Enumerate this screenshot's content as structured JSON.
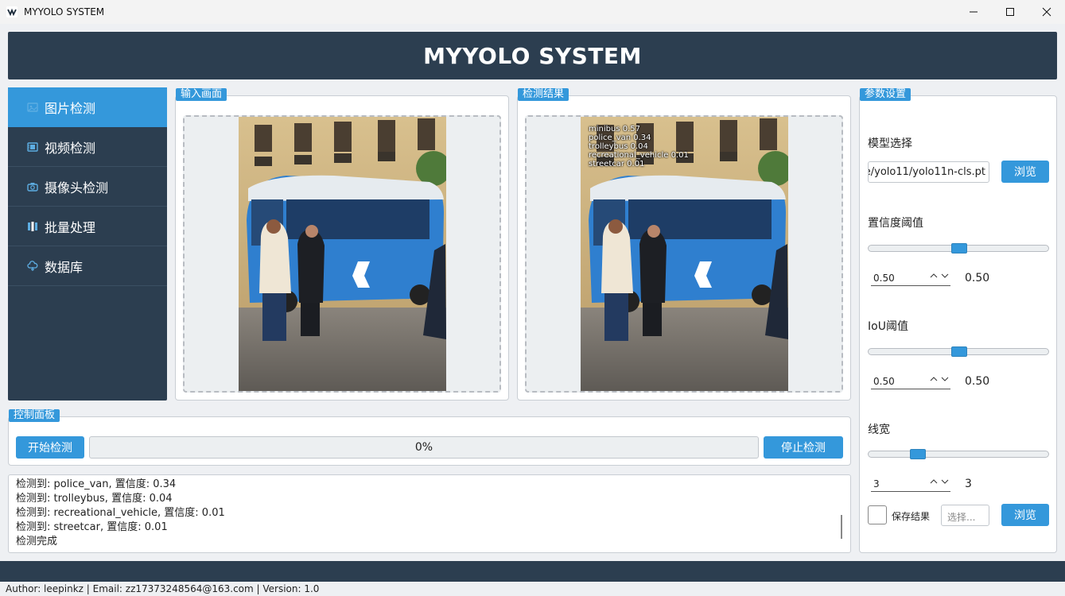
{
  "window": {
    "title": "MYYOLO SYSTEM"
  },
  "header": {
    "title": "MYYOLO SYSTEM"
  },
  "sidebar": {
    "items": [
      {
        "label": "图片检测",
        "icon": "image-icon"
      },
      {
        "label": "视频检测",
        "icon": "film-icon"
      },
      {
        "label": "摄像头检测",
        "icon": "camera-icon"
      },
      {
        "label": "批量处理",
        "icon": "batch-icon"
      },
      {
        "label": "数据库",
        "icon": "cloud-database-icon"
      }
    ]
  },
  "input_panel": {
    "title": "输入画面"
  },
  "result_panel": {
    "title": "检测结果",
    "detections": [
      "minibus 0.57",
      "police_van 0.34",
      "trolleybus 0.04",
      "recreational_vehicle 0.01",
      "streetcar 0.01"
    ]
  },
  "control_panel": {
    "title": "控制面板",
    "start_label": "开始检测",
    "stop_label": "停止检测",
    "progress": {
      "percent": 0,
      "text": "0%"
    }
  },
  "log": {
    "lines": [
      "检测到: police_van, 置信度: 0.34",
      "检测到: trolleybus, 置信度: 0.04",
      "检测到: recreational_vehicle, 置信度: 0.01",
      "检测到: streetcar, 置信度: 0.01",
      "检测完成"
    ]
  },
  "settings": {
    "title": "参数设置",
    "model_label": "模型选择",
    "model_path": "e/yolo11/yolo11n-cls.pt",
    "browse_label": "浏览",
    "confidence": {
      "label": "置信度阈值",
      "spin": "0.50",
      "value": "0.50",
      "fraction": 0.5
    },
    "iou": {
      "label": "IoU阈值",
      "spin": "0.50",
      "value": "0.50",
      "fraction": 0.5
    },
    "linewidth": {
      "label": "线宽",
      "spin": "3",
      "value": "3",
      "fraction": 0.25
    },
    "save_label": "保存结果",
    "save_placeholder": "选择...",
    "save_browse_label": "浏览"
  },
  "status": {
    "text": "Author: leepinkz | Email: zz17373248564@163.com | Version: 1.0"
  },
  "colors": {
    "navy": "#2c3e50",
    "accent": "#3498db"
  }
}
